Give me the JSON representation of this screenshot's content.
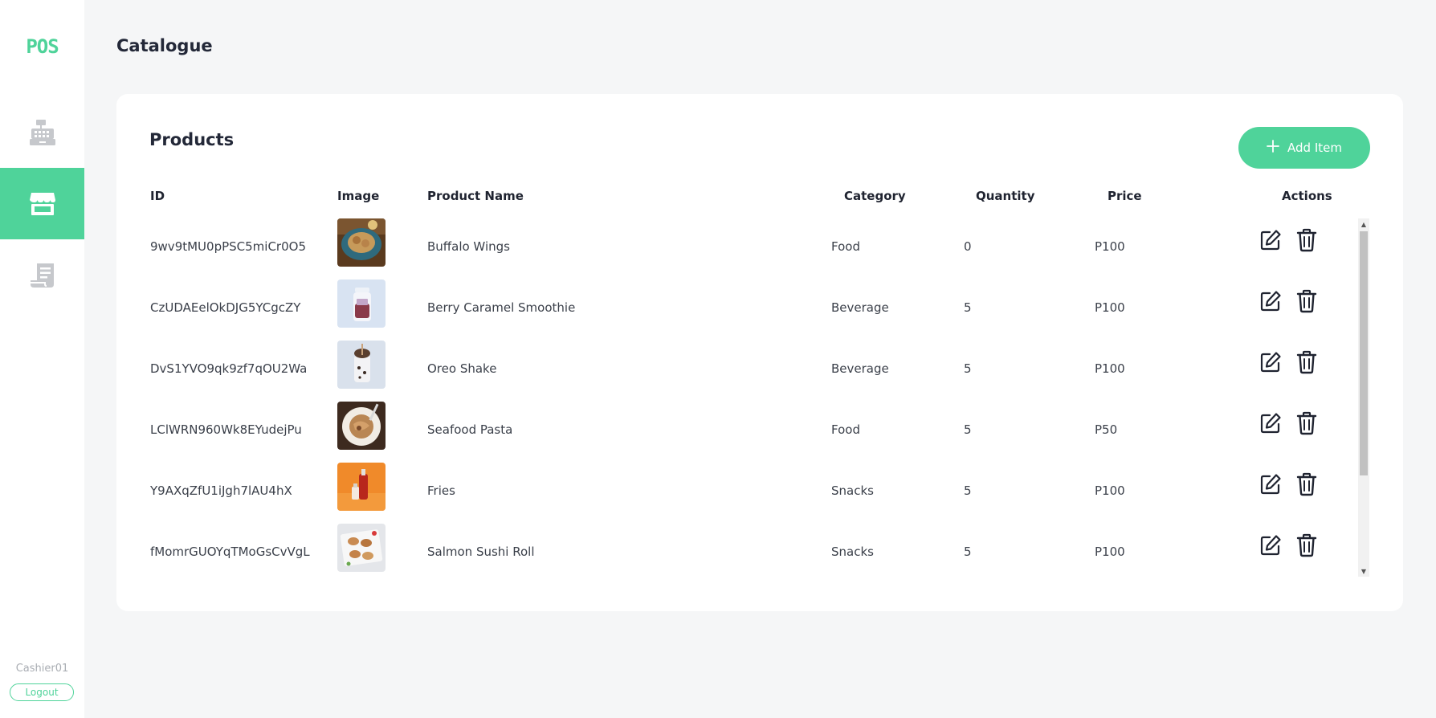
{
  "app": {
    "logo": "POS",
    "page_title": "Catalogue",
    "user": "Cashier01",
    "logout_label": "Logout"
  },
  "nav": [
    {
      "icon": "cash-register-icon",
      "active": false
    },
    {
      "icon": "store-icon",
      "active": true
    },
    {
      "icon": "receipt-icon",
      "active": false
    }
  ],
  "products": {
    "title": "Products",
    "add_label": "Add Item",
    "columns": {
      "id": "ID",
      "image": "Image",
      "name": "Product Name",
      "category": "Category",
      "quantity": "Quantity",
      "price": "Price",
      "actions": "Actions"
    },
    "rows": [
      {
        "id": "9wv9tMU0pPSC5miCr0O5",
        "name": "Buffalo Wings",
        "category": "Food",
        "quantity": "0",
        "price": "P100",
        "thumb": "food-bowl"
      },
      {
        "id": "CzUDAEelOkDJG5YCgcZY",
        "name": "Berry Caramel Smoothie",
        "category": "Beverage",
        "quantity": "5",
        "price": "P100",
        "thumb": "smoothie-jar"
      },
      {
        "id": "DvS1YVO9qk9zf7qOU2Wa",
        "name": "Oreo Shake",
        "category": "Beverage",
        "quantity": "5",
        "price": "P100",
        "thumb": "shake-jar"
      },
      {
        "id": "LClWRN960Wk8EYudejPu",
        "name": "Seafood Pasta",
        "category": "Food",
        "quantity": "5",
        "price": "P50",
        "thumb": "pasta-plate"
      },
      {
        "id": "Y9AXqZfU1iJgh7lAU4hX",
        "name": "Fries",
        "category": "Snacks",
        "quantity": "5",
        "price": "P100",
        "thumb": "orange-bottles"
      },
      {
        "id": "fMomrGUOYqTMoGsCvVgL",
        "name": "Salmon Sushi Roll",
        "category": "Snacks",
        "quantity": "5",
        "price": "P100",
        "thumb": "sushi-plate"
      }
    ]
  },
  "colors": {
    "accent": "#4fd39a",
    "background": "#f5f6f7",
    "card": "#ffffff",
    "nav_icon_inactive": "#c6c8cc"
  }
}
